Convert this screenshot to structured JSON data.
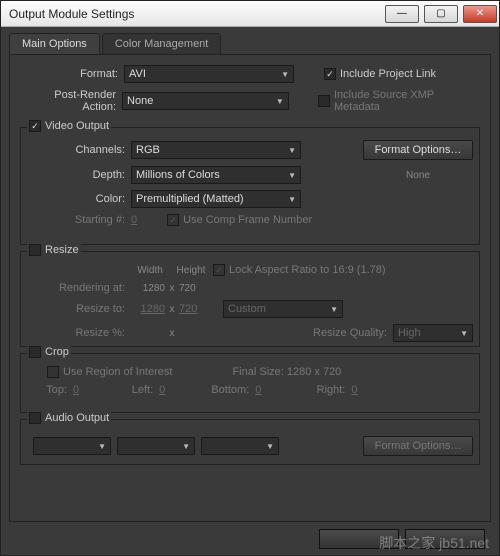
{
  "title": "Output Module Settings",
  "tabs": {
    "main": "Main Options",
    "color": "Color Management"
  },
  "format": {
    "label": "Format:",
    "value": "AVI",
    "include_project_link": "Include Project Link",
    "include_project_link_checked": true
  },
  "post_render": {
    "label": "Post-Render Action:",
    "value": "None",
    "include_xmp": "Include Source XMP Metadata",
    "include_xmp_checked": false
  },
  "video_output": {
    "header": "Video Output",
    "checked": true,
    "channels_label": "Channels:",
    "channels_value": "RGB",
    "depth_label": "Depth:",
    "depth_value": "Millions of Colors",
    "color_label": "Color:",
    "color_value": "Premultiplied (Matted)",
    "starting_label": "Starting #:",
    "starting_value": "0",
    "use_comp_frame": "Use Comp Frame Number",
    "format_options_btn": "Format Options…",
    "format_options_status": "None"
  },
  "resize": {
    "header": "Resize",
    "checked": false,
    "width_label": "Width",
    "height_label": "Height",
    "lock_aspect": "Lock Aspect Ratio to 16:9 (1.78)",
    "rendering_at_label": "Rendering at:",
    "rendering_w": "1280",
    "rendering_h": "720",
    "resize_to_label": "Resize to:",
    "resize_w": "1280",
    "resize_h": "720",
    "preset": "Custom",
    "resize_pct_label": "Resize %:",
    "x": "x",
    "quality_label": "Resize Quality:",
    "quality_value": "High"
  },
  "crop": {
    "header": "Crop",
    "checked": false,
    "use_roi": "Use Region of Interest",
    "final_size_label": "Final Size: 1280 x 720",
    "top_label": "Top:",
    "top_v": "0",
    "left_label": "Left:",
    "left_v": "0",
    "bottom_label": "Bottom:",
    "bottom_v": "0",
    "right_label": "Right:",
    "right_v": "0"
  },
  "audio": {
    "header": "Audio Output",
    "checked": false,
    "format_options_btn": "Format Options…"
  },
  "watermark": "脚本之家 jb51.net"
}
